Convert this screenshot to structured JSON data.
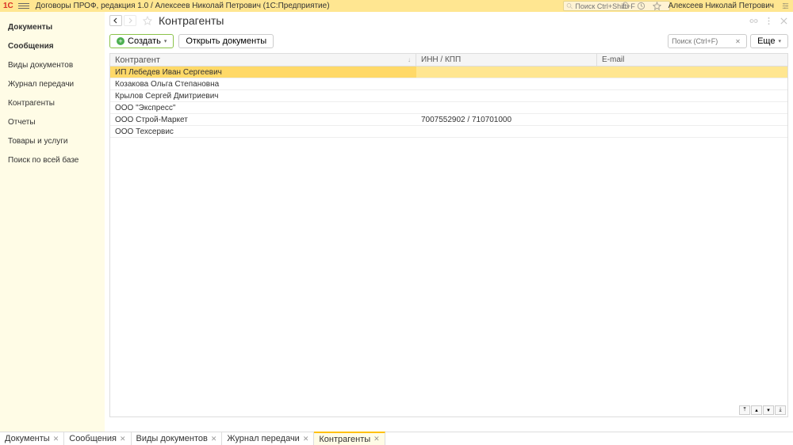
{
  "titlebar": {
    "logo": "1C",
    "title": "Договоры ПРОФ, редакция 1.0 / Алексеев Николай Петрович  (1С:Предприятие)",
    "search_placeholder": "Поиск Ctrl+Shift+F",
    "username": "Алексеев Николай Петрович"
  },
  "sidebar": {
    "items": [
      {
        "label": "Документы",
        "bold": true
      },
      {
        "label": "Сообщения",
        "bold": true
      },
      {
        "label": "Виды документов",
        "bold": false
      },
      {
        "label": "Журнал передачи",
        "bold": false
      },
      {
        "label": "Контрагенты",
        "bold": false
      },
      {
        "label": "Отчеты",
        "bold": false
      },
      {
        "label": "Товары и услуги",
        "bold": false
      },
      {
        "label": "Поиск по всей базе",
        "bold": false
      }
    ]
  },
  "page": {
    "title": "Контрагенты",
    "create_label": "Создать",
    "open_docs_label": "Открыть документы",
    "search_placeholder": "Поиск (Ctrl+F)",
    "more_label": "Еще"
  },
  "table": {
    "columns": [
      "Контрагент",
      "ИНН / КПП",
      "E-mail"
    ],
    "rows": [
      {
        "name": "ИП Лебедев Иван Сергеевич",
        "inn": "",
        "email": "",
        "selected": true
      },
      {
        "name": "Козакова Ольга Степановна",
        "inn": "",
        "email": ""
      },
      {
        "name": "Крылов Сергей Дмитриевич",
        "inn": "",
        "email": ""
      },
      {
        "name": "ООО \"Экспресс\"",
        "inn": "",
        "email": ""
      },
      {
        "name": "ООО Строй-Маркет",
        "inn": "7007552902 / 710701000",
        "email": ""
      },
      {
        "name": "ООО Техсервис",
        "inn": "",
        "email": ""
      }
    ]
  },
  "tabs": [
    {
      "label": "Документы",
      "active": false
    },
    {
      "label": "Сообщения",
      "active": false
    },
    {
      "label": "Виды документов",
      "active": false
    },
    {
      "label": "Журнал передачи",
      "active": false
    },
    {
      "label": "Контрагенты",
      "active": true
    }
  ]
}
